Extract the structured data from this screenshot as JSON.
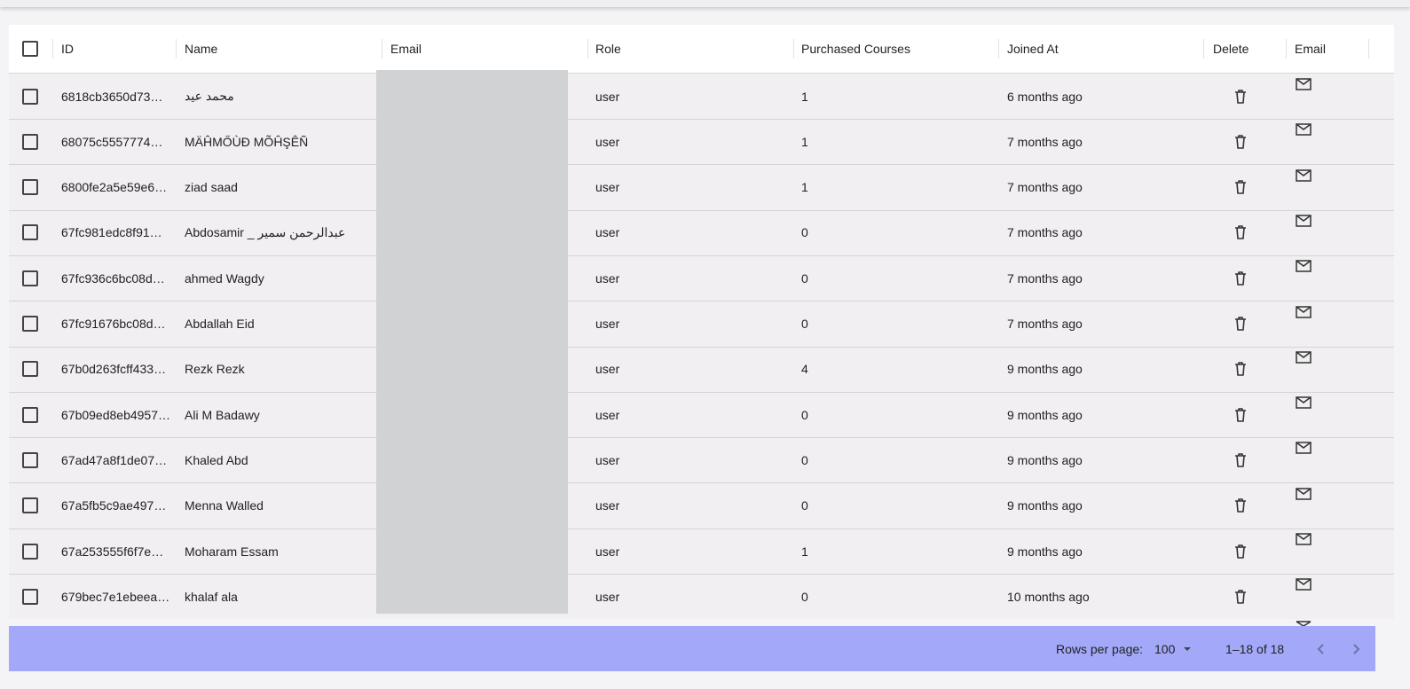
{
  "table": {
    "columns": {
      "id": "ID",
      "name": "Name",
      "email": "Email",
      "role": "Role",
      "purchased": "Purchased Courses",
      "joined": "Joined At",
      "delete": "Delete",
      "email_action": "Email"
    },
    "rows": [
      {
        "id": "6818cb3650d73…",
        "name": "محمد عيد",
        "role": "user",
        "purchased": "1",
        "joined": "6 months ago"
      },
      {
        "id": "68075c5557774…",
        "name": "MÄĤMŐÙĐ MÕĤŞÊÑ",
        "role": "user",
        "purchased": "1",
        "joined": "7 months ago"
      },
      {
        "id": "6800fe2a5e59e6…",
        "name": "ziad saad",
        "role": "user",
        "purchased": "1",
        "joined": "7 months ago"
      },
      {
        "id": "67fc981edc8f91…",
        "name": "Abdosamir _ عبدالرحمن سمير",
        "role": "user",
        "purchased": "0",
        "joined": "7 months ago"
      },
      {
        "id": "67fc936c6bc08d…",
        "name": "ahmed Wagdy",
        "role": "user",
        "purchased": "0",
        "joined": "7 months ago"
      },
      {
        "id": "67fc91676bc08d…",
        "name": "Abdallah Eid",
        "role": "user",
        "purchased": "0",
        "joined": "7 months ago"
      },
      {
        "id": "67b0d263fcff433…",
        "name": "Rezk Rezk",
        "role": "user",
        "purchased": "4",
        "joined": "9 months ago"
      },
      {
        "id": "67b09ed8eb4957…",
        "name": "Ali M Badawy",
        "role": "user",
        "purchased": "0",
        "joined": "9 months ago"
      },
      {
        "id": "67ad47a8f1de07…",
        "name": "Khaled Abd",
        "role": "user",
        "purchased": "0",
        "joined": "9 months ago"
      },
      {
        "id": "67a5fb5c9ae497…",
        "name": "Menna Walled",
        "role": "user",
        "purchased": "0",
        "joined": "9 months ago"
      },
      {
        "id": "67a253555f6f7e…",
        "name": "Moharam Essam",
        "role": "user",
        "purchased": "1",
        "joined": "9 months ago"
      },
      {
        "id": "679bec7e1ebeea…",
        "name": "khalaf ala",
        "role": "user",
        "purchased": "0",
        "joined": "10 months ago"
      }
    ]
  },
  "footer": {
    "rows_per_page_label": "Rows per page:",
    "rows_per_page_value": "100",
    "range": "1–18 of 18"
  },
  "icons": {
    "delete": "trash-icon",
    "email": "mail-icon",
    "prev": "chevron-left-icon",
    "next": "chevron-right-icon",
    "select": "chevron-down-icon"
  },
  "colors": {
    "footer_bg": "#a3a8f8",
    "row_bg": "#f1eff1",
    "header_bg": "#ffffff",
    "redaction": "#d1d2d4"
  }
}
